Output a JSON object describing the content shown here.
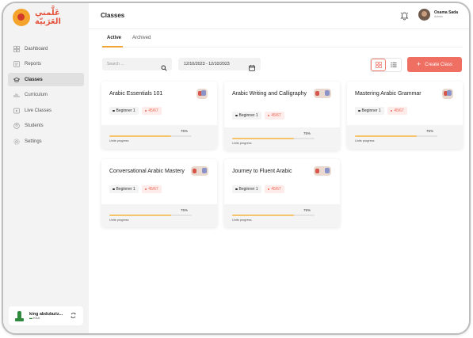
{
  "app": {
    "logo_text": "عَلَّمني العَرَبيّة"
  },
  "sidebar": {
    "items": [
      {
        "label": "Dashboard",
        "icon": "dashboard-icon",
        "active": false
      },
      {
        "label": "Reports",
        "icon": "reports-icon",
        "active": false
      },
      {
        "label": "Classes",
        "icon": "classes-icon",
        "active": true
      },
      {
        "label": "Curriculum",
        "icon": "curriculum-icon",
        "active": false
      },
      {
        "label": "Live Classes",
        "icon": "live-classes-icon",
        "active": false
      },
      {
        "label": "Students",
        "icon": "students-icon",
        "active": false
      },
      {
        "label": "Settings",
        "icon": "settings-icon",
        "active": false
      }
    ],
    "account": {
      "name": "king abdulaziz...",
      "country": "KSA"
    }
  },
  "header": {
    "title": "Classes",
    "user": {
      "name": "Osama Sada",
      "role": "Admin"
    }
  },
  "tabs": [
    {
      "label": "Active",
      "active": true
    },
    {
      "label": "Archived",
      "active": false
    }
  ],
  "filters": {
    "search_placeholder": "Search ...",
    "date_range": "12/10/2023 - 12/10/2023"
  },
  "actions": {
    "create_label": "Create Class"
  },
  "classes": [
    {
      "title": "Arabic Essentials 101",
      "level": "Beginner 1",
      "count": "45/67",
      "progress_text": "75%",
      "progress": 0.75,
      "progress_label": "Units progress"
    },
    {
      "title": "Arabic Writing and Calligraphy",
      "level": "Beginner 1",
      "count": "45/67",
      "progress_text": "75%",
      "progress": 0.75,
      "progress_label": "Units progress"
    },
    {
      "title": "Mastering Arabic Grammar",
      "level": "Beginner 1",
      "count": "45/67",
      "progress_text": "75%",
      "progress": 0.75,
      "progress_label": "Units progress"
    },
    {
      "title": "Conversational Arabic Mastery",
      "level": "Beginner 1",
      "count": "45/67",
      "progress_text": "75%",
      "progress": 0.75,
      "progress_label": "Units progress"
    },
    {
      "title": "Journey to Fluent Arabic",
      "level": "Beginner 1",
      "count": "45/67",
      "progress_text": "75%",
      "progress": 0.75,
      "progress_label": "Units progress"
    }
  ],
  "colors": {
    "accent": "#ef6f63",
    "progress": "#f5c46b",
    "tab_underline": "#f1a336",
    "badge_text": "#ec6758"
  }
}
